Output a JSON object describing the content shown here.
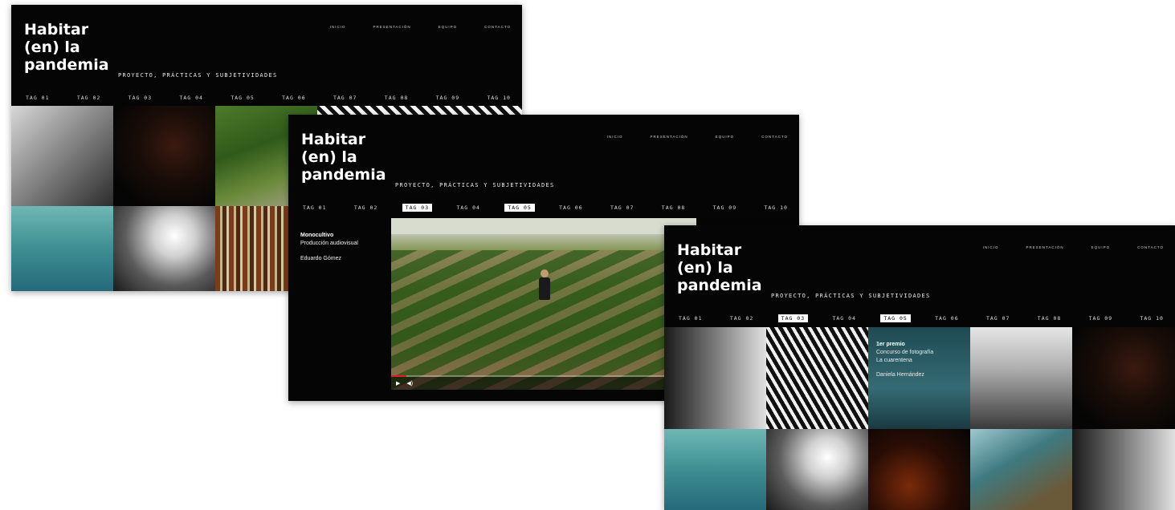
{
  "site": {
    "logo_lines": [
      "Habitar",
      "(en) la",
      "pandemia"
    ],
    "subtitle": "PROYECTO, PRÁCTICAS Y SUBJETIVIDADES",
    "nav": [
      "INICIO",
      "PRESENTACIÓN",
      "EQUIPO",
      "CONTACTO"
    ],
    "tags": [
      "TAG 01",
      "TAG 02",
      "TAG 03",
      "TAG 04",
      "TAG 05",
      "TAG 06",
      "TAG 07",
      "TAG 08",
      "TAG 09",
      "TAG 10"
    ]
  },
  "window2": {
    "active_tags": [
      "TAG 03",
      "TAG 05"
    ],
    "title": "Monocultivo",
    "category": "Producción audiovisual",
    "author": "Eduardo Gómez",
    "video_progress_fraction": 0.05
  },
  "window3": {
    "active_tags": [
      "TAG 03",
      "TAG 05"
    ],
    "prize": "1er premio",
    "contest": "Concurso de fotografía",
    "contest_name": "La cuarentena",
    "author": "Daniela Hernández"
  },
  "icons": {
    "play": "play-icon",
    "volume": "volume-icon",
    "fullscreen": "fullscreen-icon"
  }
}
